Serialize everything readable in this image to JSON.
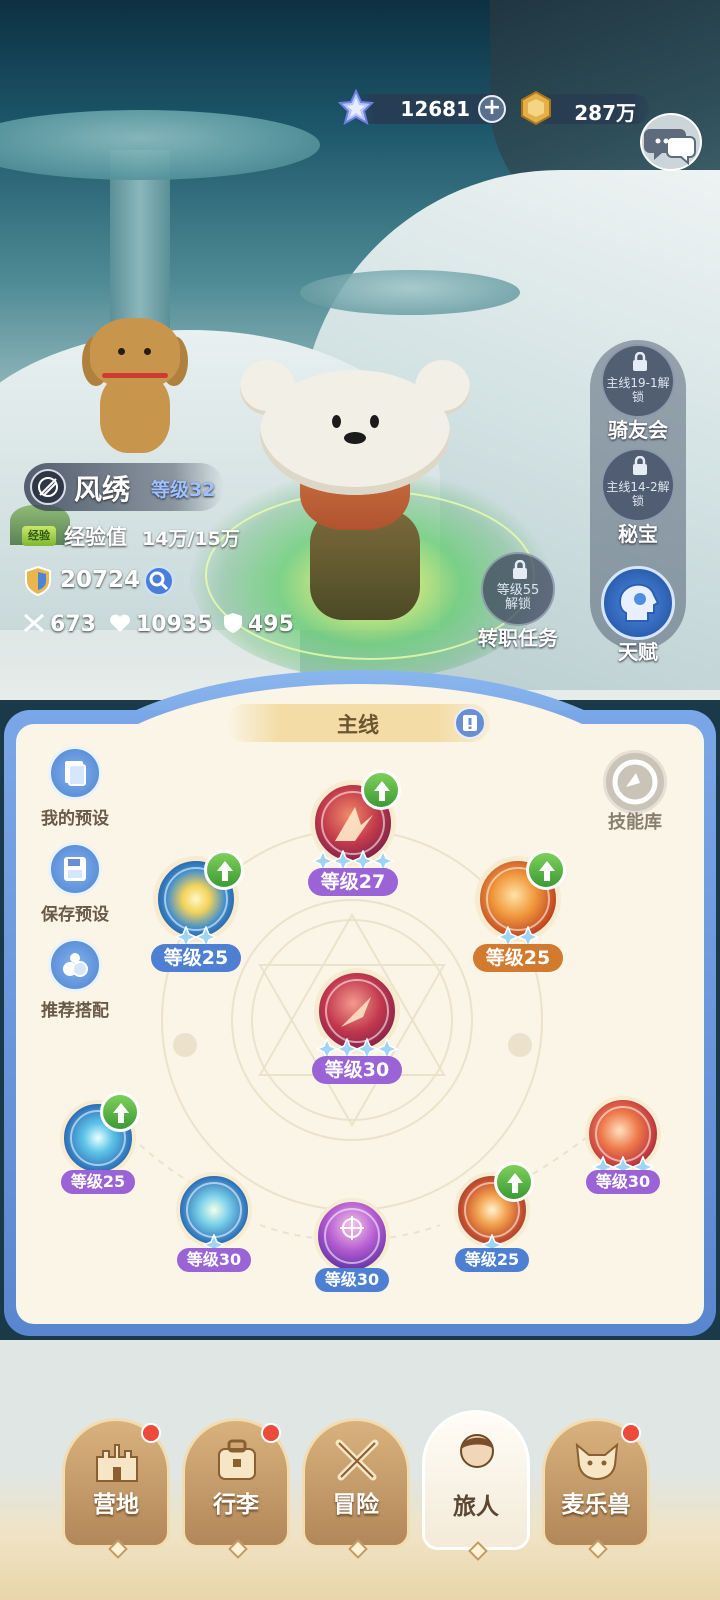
{
  "currency": {
    "gems": "12681",
    "gems_add": "+",
    "gold": "287万"
  },
  "player": {
    "name": "风绣",
    "level": "等级32",
    "exp_tag": "经验",
    "exp_label": "经验值",
    "exp_value": "14万/15万",
    "power": "20724",
    "attack": "673",
    "hp": "10935",
    "defense": "495"
  },
  "side_buttons": [
    {
      "lock_text": "主线19-1解锁",
      "label": "骑友会"
    },
    {
      "lock_text": "主线14-2解锁",
      "label": "秘宝"
    },
    {
      "label": "天赋"
    }
  ],
  "job_quest": {
    "lock_text": "等级55解锁",
    "label": "转职任务"
  },
  "board": {
    "tab_label": "主线",
    "tools": [
      {
        "label": "我的预设",
        "icon": "preset-icon"
      },
      {
        "label": "保存预设",
        "icon": "save-icon"
      },
      {
        "label": "推荐搭配",
        "icon": "recommend-icon"
      }
    ],
    "skill_library_label": "技能库",
    "skills": [
      {
        "id": "top",
        "level": "等级27",
        "stars": 4,
        "upgrade": true
      },
      {
        "id": "left",
        "level": "等级25",
        "stars": 2,
        "upgrade": true
      },
      {
        "id": "right",
        "level": "等级25",
        "stars": 2,
        "upgrade": true
      },
      {
        "id": "center",
        "level": "等级30",
        "stars": 4,
        "upgrade": false
      },
      {
        "id": "row1",
        "level": "等级25",
        "stars": 0,
        "upgrade": true
      },
      {
        "id": "row2",
        "level": "等级30",
        "stars": 1,
        "upgrade": false
      },
      {
        "id": "row3",
        "level": "等级30",
        "stars": 0,
        "upgrade": false
      },
      {
        "id": "row4",
        "level": "等级25",
        "stars": 1,
        "upgrade": true
      },
      {
        "id": "row5",
        "level": "等级30",
        "stars": 3,
        "upgrade": false
      }
    ]
  },
  "nav": [
    {
      "label": "营地",
      "badge": true
    },
    {
      "label": "行李",
      "badge": true
    },
    {
      "label": "冒险",
      "badge": false
    },
    {
      "label": "旅人",
      "badge": false,
      "active": true
    },
    {
      "label": "麦乐兽",
      "badge": true
    }
  ],
  "colors": {
    "accent_blue": "#5a86cf",
    "board_bg": "#fbf5e7",
    "level_purple": "#9a63d6",
    "level_blue": "#4d7fd3",
    "level_orange": "#d27a2e",
    "badge_red": "#ec4a3a",
    "upgrade_green": "#4faa3c"
  }
}
